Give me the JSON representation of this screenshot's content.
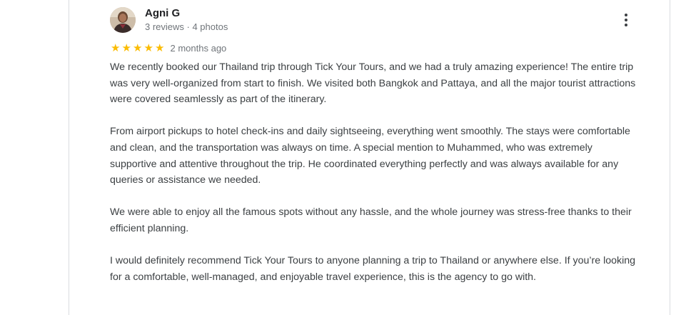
{
  "review": {
    "author_name": "Agni G",
    "author_meta": "3 reviews · 4 photos",
    "rating": 5,
    "rating_max": 5,
    "star_glyph": "★",
    "star_color": "#fbbc04",
    "date": "2 months ago",
    "more_icon": "more-vert-icon",
    "paragraphs": [
      "We recently booked our Thailand trip through Tick Your Tours, and we had a truly amazing experience! The entire trip was very well-organized from start to finish. We visited both Bangkok and Pattaya, and all the major tourist attractions were covered seamlessly as part of the itinerary.",
      "From airport pickups to hotel check-ins and daily sightseeing, everything went smoothly. The stays were comfortable and clean, and the transportation was always on time. A special mention to Muhammed, who was extremely supportive and attentive throughout the trip. He coordinated everything perfectly and was always available for any queries or assistance we needed.",
      "We were able to enjoy all the famous spots without any hassle, and the whole journey was stress-free thanks to their efficient planning.",
      "I would definitely recommend Tick Your Tours to anyone planning a trip to Thailand or anywhere else. If you’re looking for a comfortable, well-managed, and enjoyable travel experience, this is the agency to go with."
    ]
  }
}
